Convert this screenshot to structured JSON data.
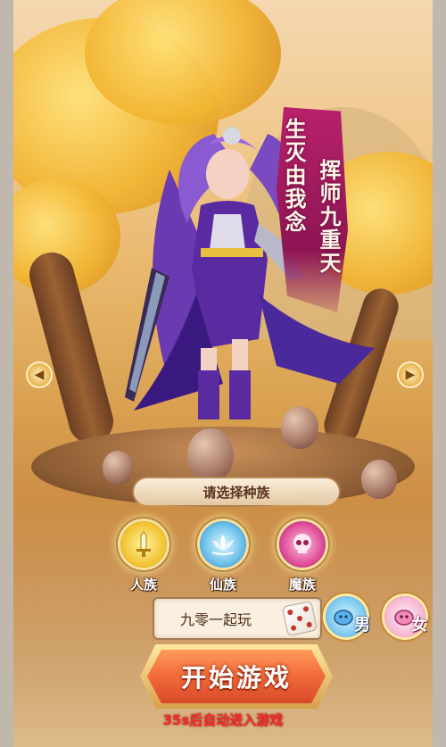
{
  "banner": {
    "left_line": "生灭由我念",
    "right_line": "挥师九重天"
  },
  "race_select": {
    "prompt": "请选择种族",
    "options": [
      {
        "label": "人族",
        "icon": "sword-icon",
        "color": "#f2c230"
      },
      {
        "label": "仙族",
        "icon": "lotus-icon",
        "color": "#4aa8d8"
      },
      {
        "label": "魔族",
        "icon": "skull-icon",
        "color": "#e0509a"
      }
    ]
  },
  "name_input": {
    "value": "九零一起玩",
    "random_button": "dice-icon"
  },
  "gender": {
    "male_label": "男",
    "female_label": "女"
  },
  "start_button": {
    "label": "开始游戏"
  },
  "countdown": {
    "text": "35s后自动进入游戏"
  },
  "nav": {
    "prev_icon": "chevron-left-icon",
    "next_icon": "chevron-right-icon"
  }
}
